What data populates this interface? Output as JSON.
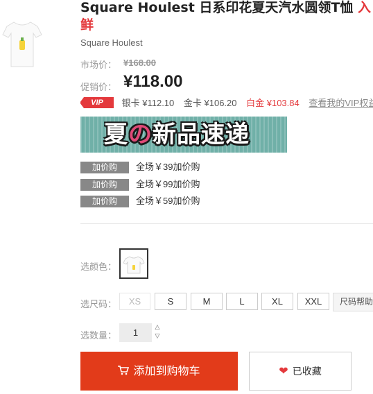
{
  "product": {
    "title_main": "Square Houlest 日系印花夏天汽水圆领T恤 ",
    "title_cut": "入",
    "title_line2": "鲜",
    "brand": "Square Houlest"
  },
  "pricing": {
    "market_label": "市场价：",
    "market_price": "¥168.00",
    "promo_label": "促销价：",
    "promo_price": "¥118.00",
    "vip_badge": "VIP",
    "vip_silver": "银卡 ¥112.10",
    "vip_gold": "金卡 ¥106.20",
    "vip_platinum": "白金 ¥103.84",
    "vip_link": "查看我的VIP权益"
  },
  "banner": {
    "text_prefix": "夏",
    "text_no": "の",
    "text_suffix": "新品速递"
  },
  "addons": [
    {
      "tag": "加价购",
      "desc": "全场￥39加价购"
    },
    {
      "tag": "加价购",
      "desc": "全场￥99加价购"
    },
    {
      "tag": "加价购",
      "desc": "全场￥59加价购"
    }
  ],
  "options": {
    "color_label": "选颜色：",
    "size_label": "选尺码：",
    "sizes": [
      "XS",
      "S",
      "M",
      "L",
      "XL",
      "XXL"
    ],
    "size_help": "尺码帮助",
    "qty_label": "选数量：",
    "qty_value": "1"
  },
  "actions": {
    "add_to_cart": "添加到购物车",
    "favorited": "已收藏"
  },
  "colors": {
    "accent_red": "#e4393c",
    "cart_button": "#e23b1a",
    "banner_bg": "#70b0a8"
  },
  "icons": [
    "cart-icon",
    "heart-icon",
    "up-arrow-icon",
    "down-arrow-icon"
  ]
}
